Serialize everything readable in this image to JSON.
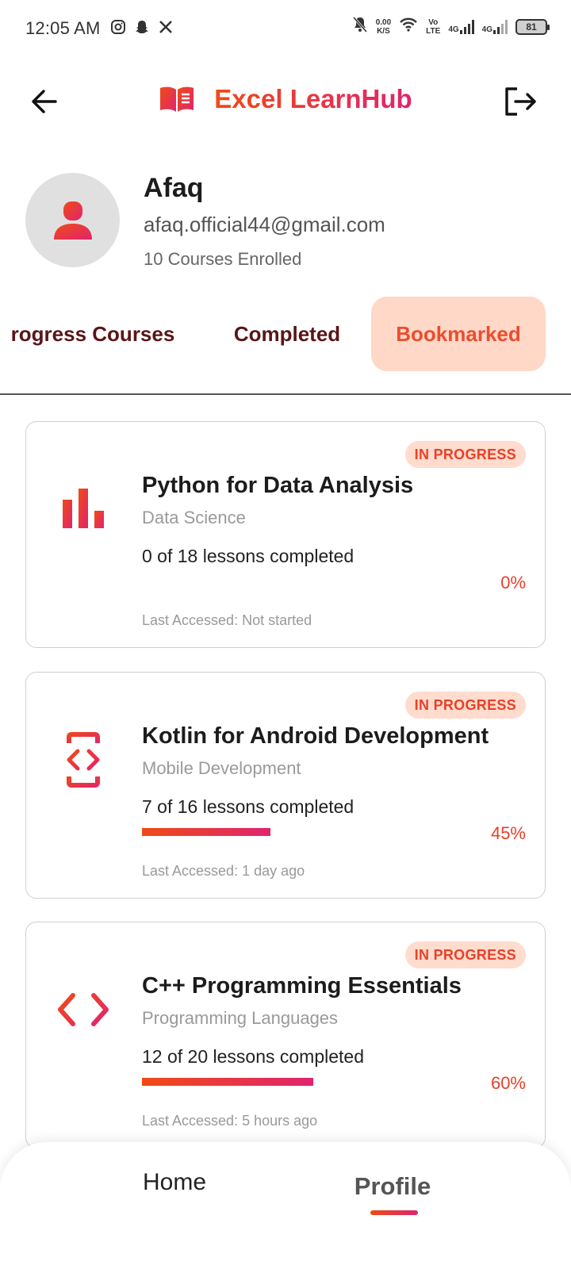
{
  "status_bar": {
    "time": "12:05 AM",
    "speed_value": "0.00",
    "speed_unit": "K/S",
    "volte_top": "Vo",
    "volte_bottom": "LTE",
    "network1": "4G",
    "network2": "4G",
    "battery": "81",
    "icons": [
      "instagram-icon",
      "snapchat-icon",
      "x-icon",
      "mute-bell-icon",
      "wifi-icon",
      "signal-icon"
    ]
  },
  "header": {
    "app_title": "Excel LearnHub",
    "back_icon": "arrow-left-icon",
    "logout_icon": "logout-icon",
    "logo_icon": "open-book-icon"
  },
  "profile": {
    "name": "Afaq",
    "email": "afaq.official44@gmail.com",
    "enrolled": "10 Courses Enrolled"
  },
  "tabs": [
    {
      "label": "rogress Courses",
      "active": false
    },
    {
      "label": "Completed",
      "active": false
    },
    {
      "label": "Bookmarked",
      "active": true
    }
  ],
  "courses": [
    {
      "status": "IN PROGRESS",
      "title": "Python for Data Analysis",
      "category": "Data Science",
      "lessons": "0 of 18 lessons completed",
      "progress_pct": 0,
      "percent_label": "0%",
      "last_accessed": "Last Accessed: Not started",
      "icon": "bar-chart-icon"
    },
    {
      "status": "IN PROGRESS",
      "title": "Kotlin for Android Development",
      "category": "Mobile Development",
      "lessons": "7 of 16 lessons completed",
      "progress_pct": 45,
      "percent_label": "45%",
      "last_accessed": "Last Accessed: 1 day ago",
      "icon": "developer-mode-icon"
    },
    {
      "status": "IN PROGRESS",
      "title": "C++ Programming Essentials",
      "category": "Programming Languages",
      "lessons": "12 of 20 lessons completed",
      "progress_pct": 60,
      "percent_label": "60%",
      "last_accessed": "Last Accessed: 5 hours ago",
      "icon": "code-icon"
    }
  ],
  "bottom_nav": {
    "home": "Home",
    "profile": "Profile",
    "active": "profile"
  },
  "colors": {
    "accent_start": "#f04a17",
    "accent_end": "#e0246e",
    "badge_bg": "#ffdccd",
    "active_tab_bg": "#ffd8c8",
    "tab_text": "#5a1518"
  }
}
